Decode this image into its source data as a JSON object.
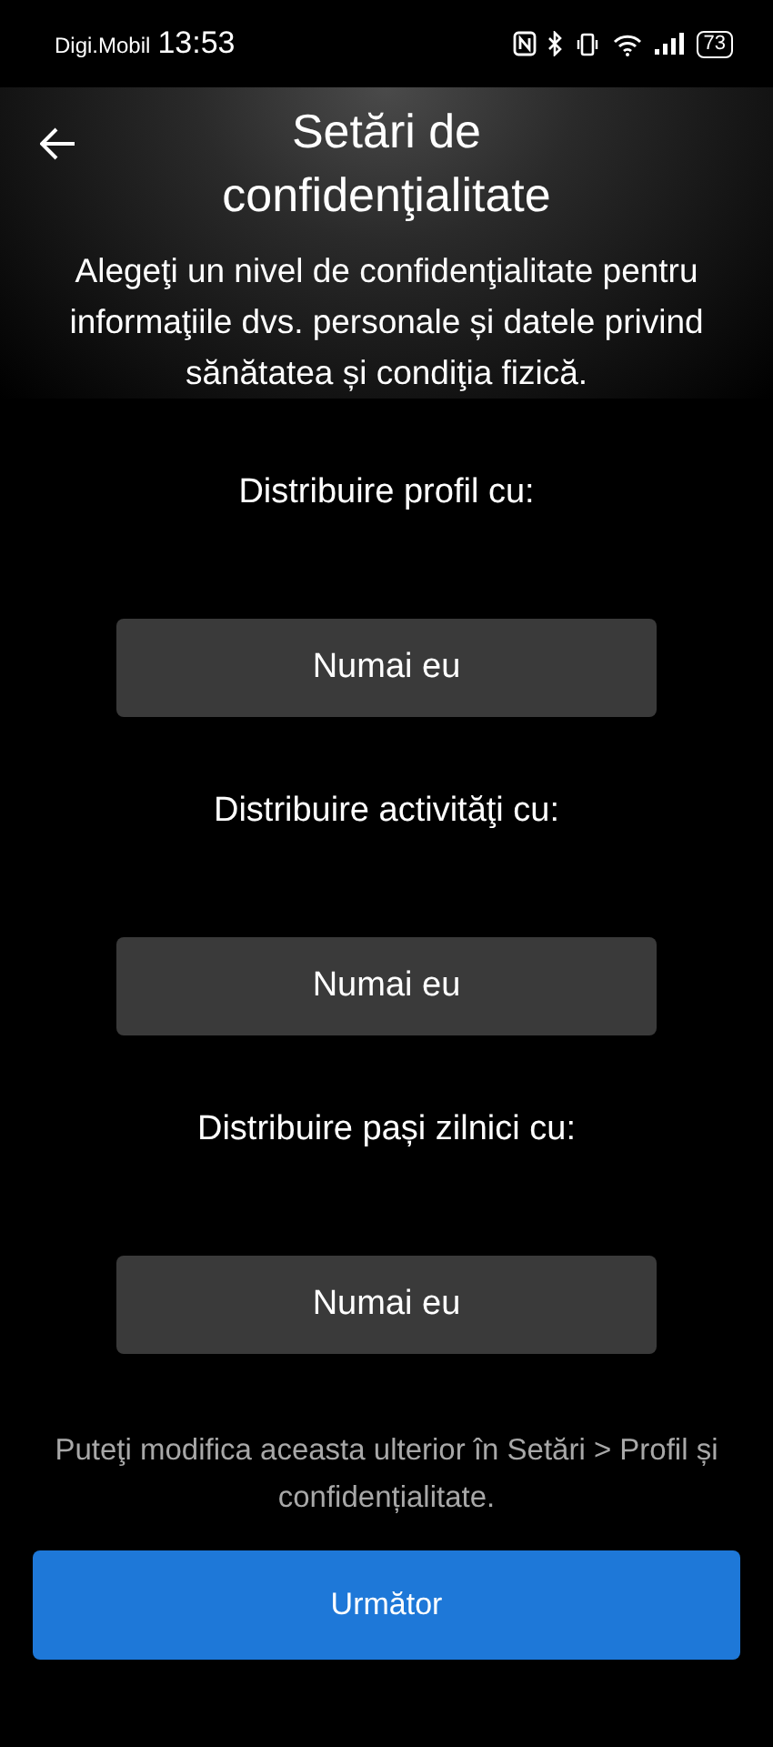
{
  "status_bar": {
    "carrier": "Digi.Mobil",
    "time": "13:53",
    "battery": "73"
  },
  "header": {
    "title": "Setări de confidenţialitate",
    "description": "Alegeţi un nivel de confidenţialitate pentru informaţiile dvs. personale și datele privind sănătatea și condiţia fizică."
  },
  "settings": [
    {
      "label": "Distribuire profil cu:",
      "value": "Numai eu"
    },
    {
      "label": "Distribuire activităţi cu:",
      "value": "Numai eu"
    },
    {
      "label": "Distribuire pași zilnici cu:",
      "value": "Numai eu"
    }
  ],
  "footer_note": "Puteţi modifica aceasta ulterior în Setări > Profil și confidențialitate.",
  "next_button": "Următor"
}
